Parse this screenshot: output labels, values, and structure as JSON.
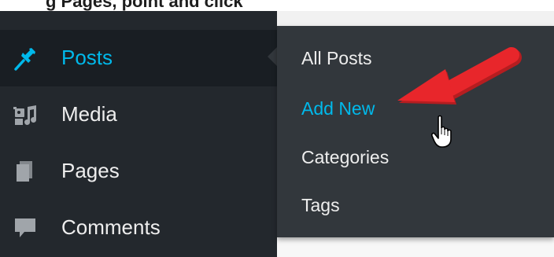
{
  "caption_fragment": "g Pages, point and click",
  "sidebar": {
    "items": [
      {
        "label": "Posts",
        "icon": "pushpin-icon",
        "active": true
      },
      {
        "label": "Media",
        "icon": "media-icon",
        "active": false
      },
      {
        "label": "Pages",
        "icon": "pages-icon",
        "active": false
      },
      {
        "label": "Comments",
        "icon": "comment-icon",
        "active": false
      }
    ]
  },
  "flyout": {
    "items": [
      {
        "label": "All Posts",
        "current": false
      },
      {
        "label": "Add New",
        "current": true
      },
      {
        "label": "Categories",
        "current": false
      },
      {
        "label": "Tags",
        "current": false
      }
    ]
  },
  "annotations": {
    "arrow_color": "#e8262b",
    "cursor": "hand-pointer-icon"
  },
  "colors": {
    "sidebar_bg": "#23282d",
    "active_item_bg": "#191e23",
    "flyout_bg": "#32373c",
    "highlight_text": "#00b9eb",
    "default_text": "#eeeeee"
  }
}
